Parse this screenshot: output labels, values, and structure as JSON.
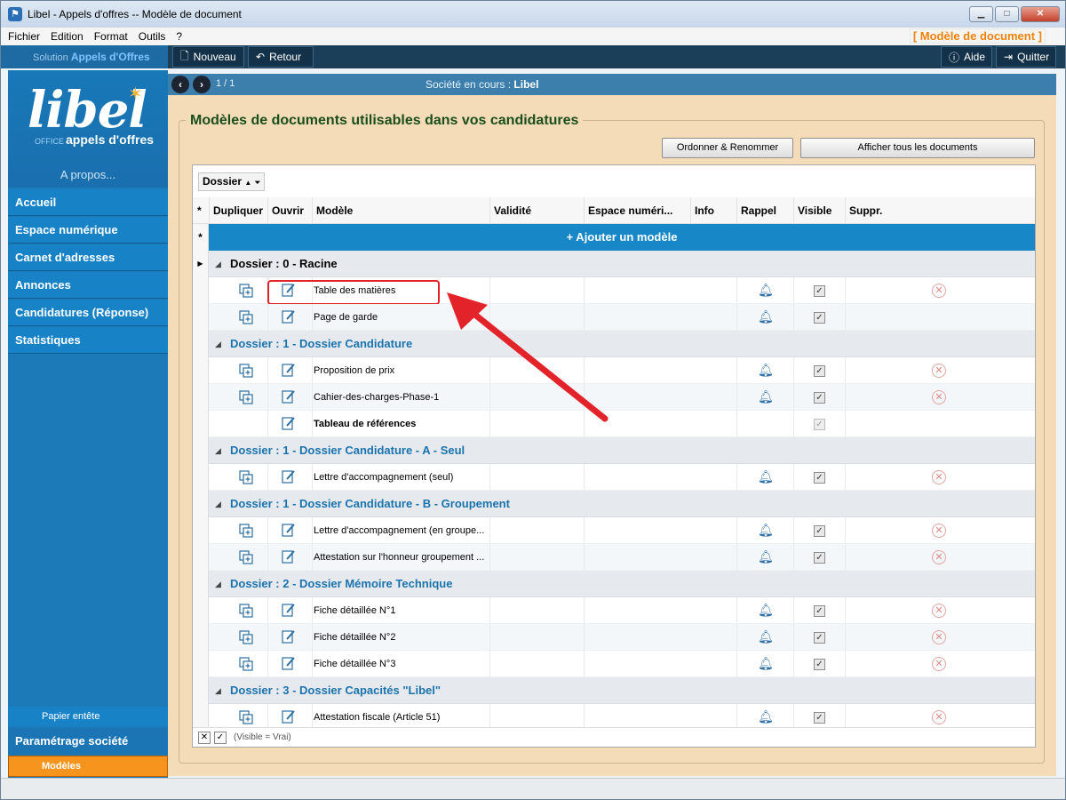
{
  "window": {
    "title": "Libel - Appels d'offres -- Modèle de document",
    "min": "▁",
    "max": "□",
    "close": "✕"
  },
  "menu": {
    "items": [
      "Fichier",
      "Edition",
      "Format",
      "Outils",
      "?"
    ],
    "context": "[ Modèle de document ]"
  },
  "toolbar": {
    "solution_prefix": "Solution",
    "solution_name": "Appels d'Offres",
    "new": "Nouveau",
    "back": "Retour",
    "help": "Aide",
    "quit": "Quitter"
  },
  "logo": {
    "word": "libel",
    "sub_small": "OFFICE",
    "sub": "appels d'offres"
  },
  "sidebar": {
    "about": "A propos...",
    "items": [
      "Accueil",
      "Espace numérique",
      "Carnet d'adresses",
      "Annonces",
      "Candidatures (Réponse)",
      "Statistiques"
    ],
    "papier": "Papier entête",
    "param": "Paramétrage société",
    "modeles": "Modèles"
  },
  "pager": {
    "page": "1 / 1",
    "soc_label": "Société en cours :",
    "soc_name": "Libel"
  },
  "panel": {
    "title": "Modèles de documents utilisables dans vos candidatures",
    "btn_order": "Ordonner & Renommer",
    "btn_show_all": "Afficher tous les documents"
  },
  "grid": {
    "group_chip": "Dossier",
    "columns": [
      "Dupliquer",
      "Ouvrir",
      "Modèle",
      "Validité",
      "Espace numéri...",
      "Info",
      "Rappel",
      "Visible",
      "Suppr."
    ],
    "add_label": "+ Ajouter un modèle",
    "groups": [
      {
        "label": "Dossier : 0 - Racine",
        "rows": [
          {
            "name": "Table des matières",
            "rappel": true,
            "visible": true,
            "dup": true,
            "del": true,
            "bold": false
          },
          {
            "name": "Page de garde",
            "rappel": true,
            "visible": true,
            "dup": true,
            "del": false,
            "bold": false
          }
        ]
      },
      {
        "label": "Dossier : 1 - Dossier Candidature",
        "rows": [
          {
            "name": "Proposition de prix",
            "rappel": true,
            "visible": true,
            "dup": true,
            "del": true,
            "bold": false
          },
          {
            "name": "Cahier-des-charges-Phase-1",
            "rappel": true,
            "visible": true,
            "dup": true,
            "del": true,
            "bold": false
          },
          {
            "name": "Tableau de références",
            "rappel": false,
            "visible": true,
            "dup": false,
            "del": false,
            "bold": true
          }
        ]
      },
      {
        "label": "Dossier : 1 - Dossier Candidature - A - Seul",
        "rows": [
          {
            "name": "Lettre d'accompagnement (seul)",
            "rappel": true,
            "visible": true,
            "dup": true,
            "del": true,
            "bold": false
          }
        ]
      },
      {
        "label": "Dossier : 1 - Dossier Candidature - B - Groupement",
        "rows": [
          {
            "name": "Lettre d'accompagnement (en groupe...",
            "rappel": true,
            "visible": true,
            "dup": true,
            "del": true,
            "bold": false
          },
          {
            "name": "Attestation sur l'honneur groupement ...",
            "rappel": true,
            "visible": true,
            "dup": true,
            "del": true,
            "bold": false
          }
        ]
      },
      {
        "label": "Dossier : 2 - Dossier Mémoire Technique",
        "rows": [
          {
            "name": "Fiche détaillée N°1",
            "rappel": true,
            "visible": true,
            "dup": true,
            "del": true,
            "bold": false
          },
          {
            "name": "Fiche détaillée N°2",
            "rappel": true,
            "visible": true,
            "dup": true,
            "del": true,
            "bold": false
          },
          {
            "name": "Fiche détaillée N°3",
            "rappel": true,
            "visible": true,
            "dup": true,
            "del": true,
            "bold": false
          }
        ]
      },
      {
        "label": "Dossier : 3 - Dossier Capacités \"Libel\"",
        "rows": [
          {
            "name": "Attestation fiscale (Article 51)",
            "rappel": true,
            "visible": true,
            "dup": true,
            "del": true,
            "bold": false
          }
        ]
      }
    ],
    "filter_text": "(Visible = Vrai)"
  },
  "colors": {
    "nav_blue": "#1882c6",
    "accent_orange": "#f7941d",
    "panel_bg": "#f4dcb8",
    "highlight_red": "#e2242a"
  }
}
